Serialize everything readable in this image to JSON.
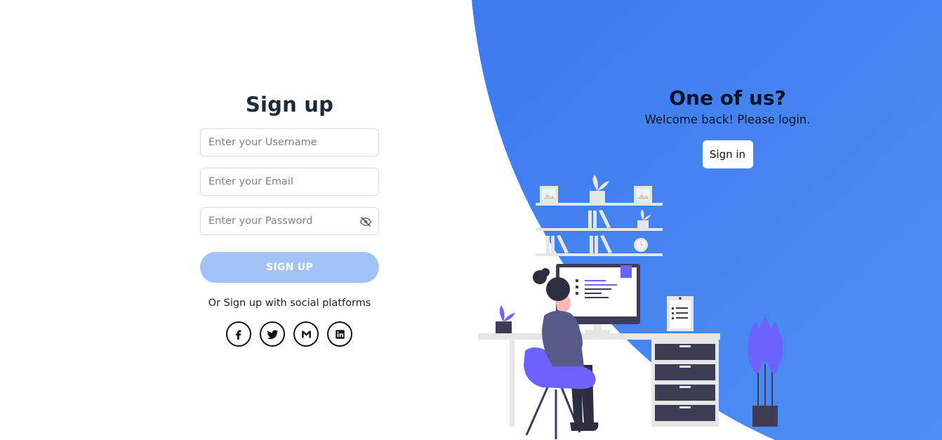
{
  "signup": {
    "title": "Sign up",
    "username_placeholder": "Enter your Username",
    "email_placeholder": "Enter your Email",
    "password_placeholder": "Enter your Password",
    "submit_label": "SIGN UP",
    "social_text": "Or Sign up with social platforms",
    "socials": [
      "facebook-icon",
      "twitter-icon",
      "gmail-icon",
      "linkedin-icon"
    ]
  },
  "panel": {
    "title": "One of us?",
    "subtitle": "Welcome back! Please login.",
    "signin_label": "Sign in"
  },
  "colors": {
    "accent": "#4a86ee",
    "button_disabled": "#a3c3f8",
    "illustration_accent": "#6c63ff",
    "dark": "#3f3d56"
  }
}
